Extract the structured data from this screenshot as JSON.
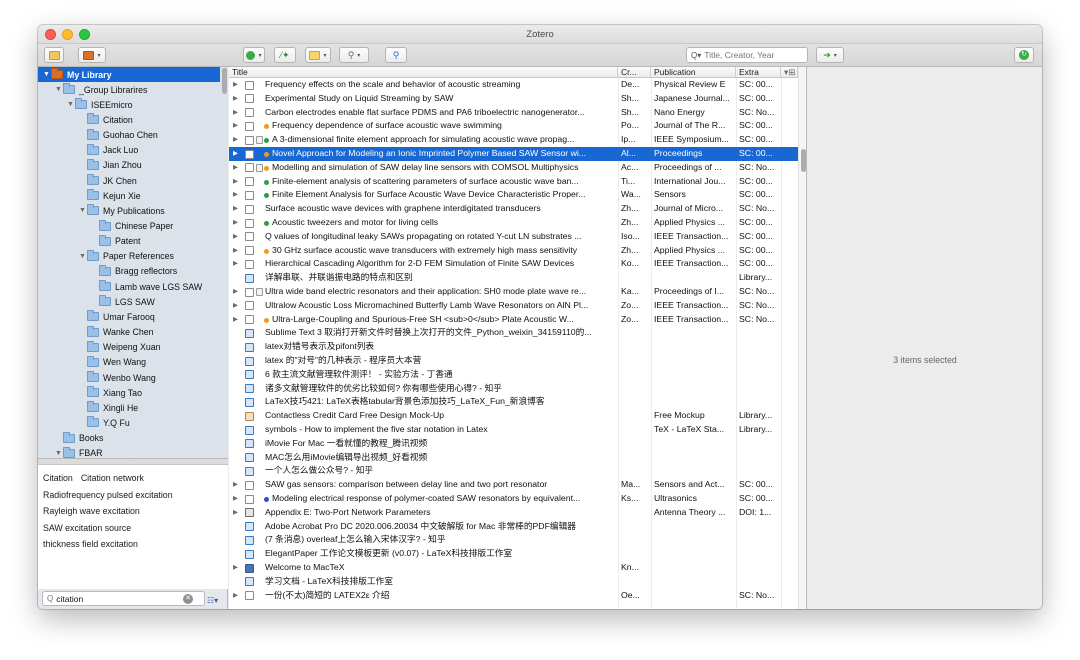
{
  "window": {
    "title": "Zotero"
  },
  "toolbar": {
    "search_placeholder": "Title, Creator, Year",
    "search_mode": "Q▾"
  },
  "library": [
    {
      "label": "My Library",
      "depth": 0,
      "expanded": true,
      "selected": true,
      "type": "lib"
    },
    {
      "label": "_Group Librarires",
      "depth": 1,
      "expanded": true
    },
    {
      "label": "ISEEmicro",
      "depth": 2,
      "expanded": true
    },
    {
      "label": "Citation",
      "depth": 3
    },
    {
      "label": "Guohao Chen",
      "depth": 3
    },
    {
      "label": "Jack Luo",
      "depth": 3
    },
    {
      "label": "Jian Zhou",
      "depth": 3
    },
    {
      "label": "JK Chen",
      "depth": 3
    },
    {
      "label": "Kejun Xie",
      "depth": 3
    },
    {
      "label": "My Publications",
      "depth": 3,
      "expanded": true
    },
    {
      "label": "Chinese Paper",
      "depth": 4
    },
    {
      "label": "Patent",
      "depth": 4
    },
    {
      "label": "Paper References",
      "depth": 3,
      "expanded": true
    },
    {
      "label": "Bragg reflectors",
      "depth": 4
    },
    {
      "label": "Lamb wave LGS SAW",
      "depth": 4
    },
    {
      "label": "LGS SAW",
      "depth": 4
    },
    {
      "label": "Umar Farooq",
      "depth": 3
    },
    {
      "label": "Wanke Chen",
      "depth": 3
    },
    {
      "label": "Weipeng Xuan",
      "depth": 3
    },
    {
      "label": "Wen Wang",
      "depth": 3
    },
    {
      "label": "Wenbo Wang",
      "depth": 3
    },
    {
      "label": "Xiang Tao",
      "depth": 3
    },
    {
      "label": "Xingli He",
      "depth": 3
    },
    {
      "label": "Y.Q Fu",
      "depth": 3
    },
    {
      "label": "Books",
      "depth": 1
    },
    {
      "label": "FBAR",
      "depth": 1,
      "expanded": true
    }
  ],
  "tags": {
    "rows": [
      [
        "Citation",
        "Citation network"
      ],
      [
        "Radiofrequency pulsed excitation"
      ],
      [
        "Rayleigh wave excitation"
      ],
      [
        "SAW excitation source"
      ],
      [
        "thickness field excitation"
      ]
    ],
    "search_value": "citation",
    "actions": "▾"
  },
  "columns": {
    "title": "Title",
    "creator": "Cr...",
    "publication": "Publication",
    "extra": "Extra"
  },
  "items": [
    {
      "title": "Frequency effects on the scale and behavior of acoustic streaming",
      "creator": "De...",
      "pub": "Physical Review E",
      "extra": "SC: 00...",
      "icon": "doc",
      "tri": true
    },
    {
      "title": "Experimental Study on Liquid Streaming by SAW",
      "creator": "Sh...",
      "pub": "Japanese Journal...",
      "extra": "SC: 00...",
      "icon": "doc",
      "tri": true
    },
    {
      "title": "Carbon electrodes enable flat surface PDMS and PA6 triboelectric nanogenerator...",
      "creator": "Sh...",
      "pub": "Nano Energy",
      "extra": "SC: No...",
      "icon": "doc",
      "tri": true
    },
    {
      "title": "Frequency dependence of surface acoustic wave swimming",
      "creator": "Po...",
      "pub": "Journal of The R...",
      "extra": "SC: 00...",
      "icon": "doc",
      "tri": true,
      "dot": "#f29a1f"
    },
    {
      "title": "A 3-dimensional finite element approach for simulating acoustic wave propag...",
      "creator": "Ip...",
      "pub": "IEEE Symposium...",
      "extra": "SC: 00...",
      "icon": "doc",
      "tri": true,
      "dot": "#2e9e3e",
      "pdf": true
    },
    {
      "title": "Novel Approach for Modeling an Ionic Imprinted Polymer Based SAW Sensor wi...",
      "creator": "Al...",
      "pub": "Proceedings",
      "extra": "SC: 00...",
      "icon": "doc",
      "tri": true,
      "dot": "#f29a1f",
      "selected": true
    },
    {
      "title": "Modelling and simulation of SAW delay line sensors with COMSOL Multiphysics",
      "creator": "Ac...",
      "pub": "Proceedings of ...",
      "extra": "SC: No...",
      "icon": "doc",
      "tri": true,
      "dot": "#f29a1f",
      "pdf": true
    },
    {
      "title": "Finite-element analysis of scattering parameters of surface acoustic wave ban...",
      "creator": "Ti...",
      "pub": "International Jou...",
      "extra": "SC: 00...",
      "icon": "doc",
      "tri": true,
      "dot": "#2e9e3e"
    },
    {
      "title": "Finite Element Analysis for Surface Acoustic Wave Device Characteristic Proper...",
      "creator": "Wa...",
      "pub": "Sensors",
      "extra": "SC: 00...",
      "icon": "doc",
      "tri": true,
      "dot": "#2e9e3e"
    },
    {
      "title": "Surface acoustic wave devices with graphene interdigitated transducers",
      "creator": "Zh...",
      "pub": "Journal of Micro...",
      "extra": "SC: No...",
      "icon": "doc",
      "tri": true
    },
    {
      "title": "Acoustic tweezers and motor for living cells",
      "creator": "Zh...",
      "pub": "Applied Physics ...",
      "extra": "SC: 00...",
      "icon": "doc",
      "tri": true,
      "dot": "#2e9e3e"
    },
    {
      "title": "Q values of longitudinal leaky SAWs propagating on rotated Y-cut LN substrates ...",
      "creator": "Iso...",
      "pub": "IEEE Transaction...",
      "extra": "SC: 00...",
      "icon": "doc",
      "tri": true
    },
    {
      "title": "30 GHz surface acoustic wave transducers with extremely high mass sensitivity",
      "creator": "Zh...",
      "pub": "Applied Physics ...",
      "extra": "SC: 00...",
      "icon": "doc",
      "tri": true,
      "dot": "#f29a1f"
    },
    {
      "title": "Hierarchical Cascading Algorithm for 2-D FEM Simulation of Finite SAW Devices",
      "creator": "Ko...",
      "pub": "IEEE Transaction...",
      "extra": "SC: 00...",
      "icon": "doc",
      "tri": true
    },
    {
      "title": "详解串联、并联谐振电路的特点和区别",
      "creator": "",
      "pub": "",
      "extra": "Library...",
      "icon": "web"
    },
    {
      "title": "Ultra wide band electric resonators and their application: SH0 mode plate wave re...",
      "creator": "Ka...",
      "pub": "Proceedings of I...",
      "extra": "SC: No...",
      "icon": "doc",
      "tri": true,
      "pdf": true
    },
    {
      "title": "Ultralow Acoustic Loss Micromachined Butterfly Lamb Wave Resonators on AlN Pl...",
      "creator": "Zo...",
      "pub": "IEEE Transaction...",
      "extra": "SC: No...",
      "icon": "doc",
      "tri": true
    },
    {
      "title": "Ultra-Large-Coupling and Spurious-Free SH <sub>0</sub> Plate Acoustic W...",
      "creator": "Zo...",
      "pub": "IEEE Transaction...",
      "extra": "SC: No...",
      "icon": "doc",
      "tri": true,
      "dot": "#f29a1f"
    },
    {
      "title": "Sublime Text 3 取消打开新文件时替换上次打开的文件_Python_weixin_34159110的...",
      "creator": "",
      "pub": "",
      "extra": "",
      "icon": "web"
    },
    {
      "title": "latex对错号表示及pifont列表",
      "creator": "",
      "pub": "",
      "extra": "",
      "icon": "web"
    },
    {
      "title": "latex 的\"对号\"的几种表示 - 程序员大本营",
      "creator": "",
      "pub": "",
      "extra": "",
      "icon": "web"
    },
    {
      "title": "6 款主流文献管理软件测评！ - 实验方法 - 丁香通",
      "creator": "",
      "pub": "",
      "extra": "",
      "icon": "web"
    },
    {
      "title": "诸多文献管理软件的优劣比较如何? 你有哪些使用心得? - 知乎",
      "creator": "",
      "pub": "",
      "extra": "",
      "icon": "web"
    },
    {
      "title": "LaTeX技巧421: LaTeX表格tabular背景色添加技巧_LaTeX_Fun_新浪博客",
      "creator": "",
      "pub": "",
      "extra": "",
      "icon": "web"
    },
    {
      "title": "Contactless Credit Card Free Design Mock-Up",
      "creator": "",
      "pub": "Free Mockup",
      "extra": "Library...",
      "icon": "img"
    },
    {
      "title": "symbols - How to implement the five star notation in Latex",
      "creator": "",
      "pub": "TeX - LaTeX Sta...",
      "extra": "Library...",
      "icon": "web"
    },
    {
      "title": "iMovie For Mac 一看就懂的教程_腾讯视频",
      "creator": "",
      "pub": "",
      "extra": "",
      "icon": "web"
    },
    {
      "title": "MAC怎么用iMovie编辑导出视频_好看视频",
      "creator": "",
      "pub": "",
      "extra": "",
      "icon": "web"
    },
    {
      "title": "一个人怎么做公众号? - 知乎",
      "creator": "",
      "pub": "",
      "extra": "",
      "icon": "web"
    },
    {
      "title": "SAW gas sensors: comparison between delay line and two port resonator",
      "creator": "Ma...",
      "pub": "Sensors and Act...",
      "extra": "SC: 00...",
      "icon": "doc",
      "tri": true
    },
    {
      "title": "Modeling electrical response of polymer-coated SAW resonators by equivalent...",
      "creator": "Ks...",
      "pub": "Ultrasonics",
      "extra": "SC: 00...",
      "icon": "doc",
      "tri": true,
      "dot": "#2456c8"
    },
    {
      "title": "Appendix E: Two-Port Network Parameters",
      "creator": "",
      "pub": "Antenna Theory ...",
      "extra": "DOI: 1...",
      "icon": "book",
      "tri": true
    },
    {
      "title": "Adobe Acrobat Pro DC 2020.006.20034 中文破解版 for Mac 非常棒的PDF编辑器",
      "creator": "",
      "pub": "",
      "extra": "",
      "icon": "web"
    },
    {
      "title": "(7 条消息) overleaf上怎么输入宋体汉字? - 知乎",
      "creator": "",
      "pub": "",
      "extra": "",
      "icon": "web"
    },
    {
      "title": "ElegantPaper 工作论文模板更新 (v0.07) - LaTeX科技排版工作室",
      "creator": "",
      "pub": "",
      "extra": "",
      "icon": "web"
    },
    {
      "title": "Welcome to MacTeX",
      "creator": "Kn...",
      "pub": "",
      "extra": "",
      "icon": "pres",
      "tri": true
    },
    {
      "title": "学习文档 - LaTeX科技排版工作室",
      "creator": "",
      "pub": "",
      "extra": "",
      "icon": "web"
    },
    {
      "title": "一份(不太)简短的 LATEX2ε 介绍",
      "creator": "Oe...",
      "pub": "",
      "extra": "SC: No...",
      "icon": "doc",
      "tri": true
    }
  ],
  "detail": {
    "message": "3 items selected"
  }
}
